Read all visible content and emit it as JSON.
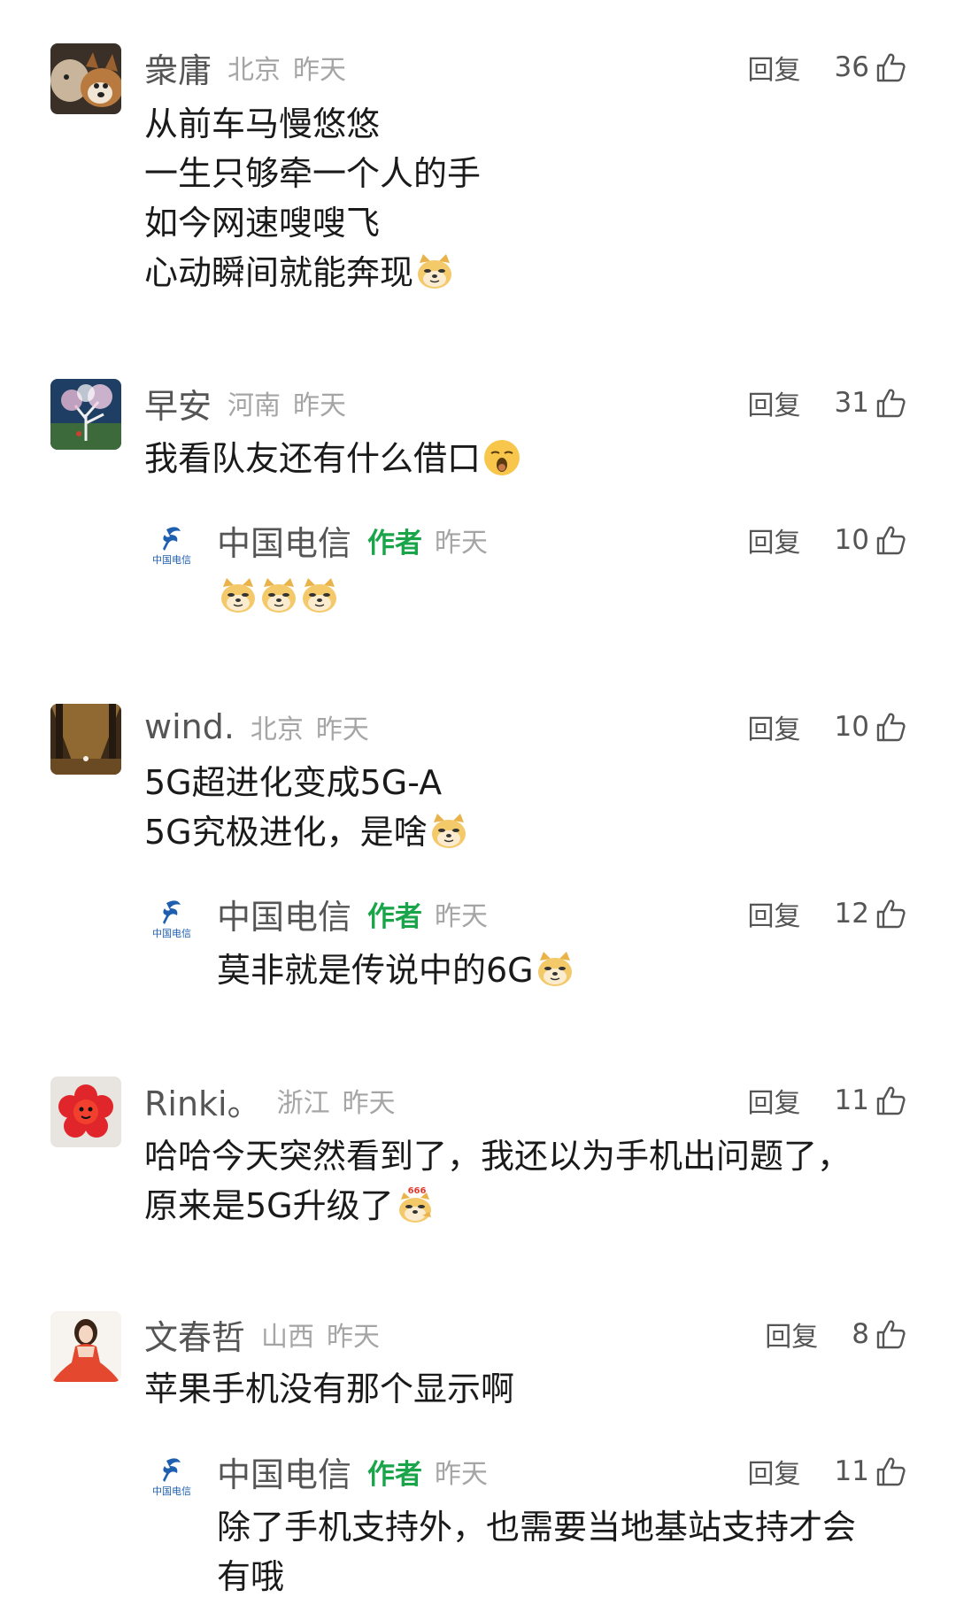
{
  "labels": {
    "reply": "回复",
    "author": "作者"
  },
  "telecom_logo_text": "中国电信",
  "comments": [
    {
      "name": "衆庸",
      "location": "北京",
      "time": "昨天",
      "likes": "36",
      "lines": [
        "从前车马慢悠悠",
        "一生只够牵一个人的手",
        "如今网速嗖嗖飞",
        "心动瞬间就能奔现"
      ],
      "trailing_emoji": "doge-emoji"
    },
    {
      "name": "早安",
      "location": "河南",
      "time": "昨天",
      "likes": "31",
      "lines": [
        "我看队友还有什么借口"
      ],
      "trailing_emoji": "yawn-emoji",
      "reply": {
        "name": "中国电信",
        "time": "昨天",
        "likes": "10",
        "lines": [
          ""
        ],
        "emojis": [
          "doge-emoji",
          "doge-emoji",
          "doge-emoji"
        ]
      }
    },
    {
      "name": "wind.",
      "location": "北京",
      "time": "昨天",
      "likes": "10",
      "lines": [
        "5G超进化变成5G-A",
        "5G究极进化，是啥"
      ],
      "trailing_emoji": "doge-emoji",
      "reply": {
        "name": "中国电信",
        "time": "昨天",
        "likes": "12",
        "lines": [
          "莫非就是传说中的6G"
        ],
        "trailing_emoji": "doge-emoji"
      }
    },
    {
      "name": "Rinki。",
      "location": "浙江",
      "time": "昨天",
      "likes": "11",
      "lines": [
        "哈哈今天突然看到了，我还以为手机出问题了，",
        "原来是5G升级了"
      ],
      "trailing_emoji": "doge-666-emoji",
      "emoji_text": "666"
    },
    {
      "name": "文春哲",
      "location": "山西",
      "time": "昨天",
      "likes": "8",
      "lines": [
        "苹果手机没有那个显示啊"
      ],
      "reply": {
        "name": "中国电信",
        "time": "昨天",
        "likes": "11",
        "lines": [
          "除了手机支持外，也需要当地基站支持才会",
          "有哦"
        ]
      }
    }
  ],
  "colors": {
    "author_tag": "#1aa54b",
    "meta_gray": "#a5a5a5",
    "name_gray": "#555555",
    "telecom_blue": "#1f5fb0"
  }
}
